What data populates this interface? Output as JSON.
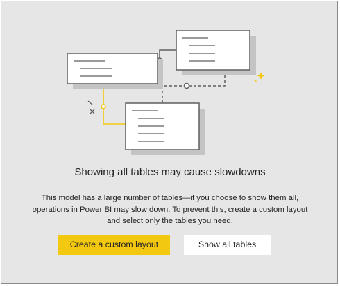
{
  "dialog": {
    "title": "Showing all tables may cause slowdowns",
    "body_lines": [
      "This model has a large number of tables—if you choose to show them all,",
      "operations in Power BI may slow down. To prevent this, create a custom layout",
      "and select only the tables you need."
    ],
    "primary_button_label": "Create a custom layout",
    "secondary_button_label": "Show all tables"
  },
  "colors": {
    "dialog_background": "#e6e6e6",
    "accent_yellow": "#f2c811",
    "line_gray": "#605e5c"
  },
  "icons": {
    "illustration": "table-relationships-diagram",
    "sparkle": "sparkle-icon"
  }
}
